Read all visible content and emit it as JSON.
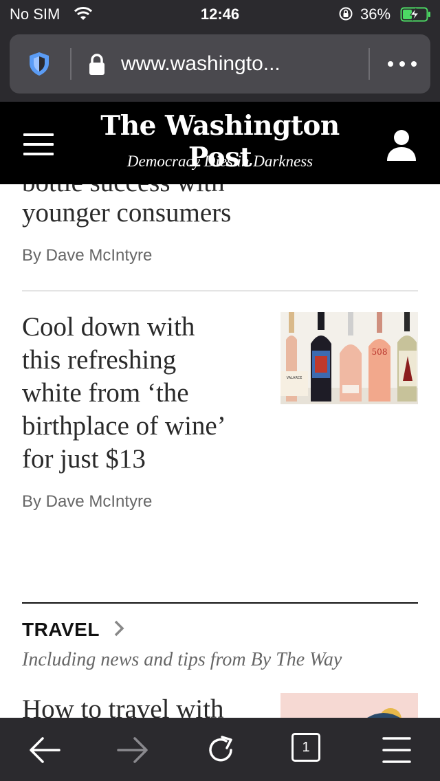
{
  "status_bar": {
    "carrier": "No SIM",
    "time": "12:46",
    "battery_percent": "36%"
  },
  "browser": {
    "url": "www.washingto...",
    "open_tabs": "1"
  },
  "masthead": {
    "title": "The Washington Post",
    "tagline": "Democracy Dies in Darkness"
  },
  "articles": [
    {
      "headline_partial_top": "bottle success with",
      "headline_line": "younger consumers",
      "byline": "By Dave McIntyre"
    },
    {
      "headline_lines": [
        "Cool down with",
        "this refreshing",
        "white from ‘the",
        "birthplace of wine’",
        "for just $13"
      ],
      "byline": "By Dave McIntyre",
      "image_labels": [
        "508",
        "VALARCE"
      ]
    }
  ],
  "travel": {
    "section_title": "TRAVEL",
    "subtitle": "Including news and tips from By The Way",
    "headline_partial": "How to travel with"
  },
  "colors": {
    "chrome": "#2b2a2e",
    "urlbar": "#4a494e",
    "masthead_bg": "#000000",
    "shield": "#5b9cf5",
    "battery": "#4cd964"
  }
}
